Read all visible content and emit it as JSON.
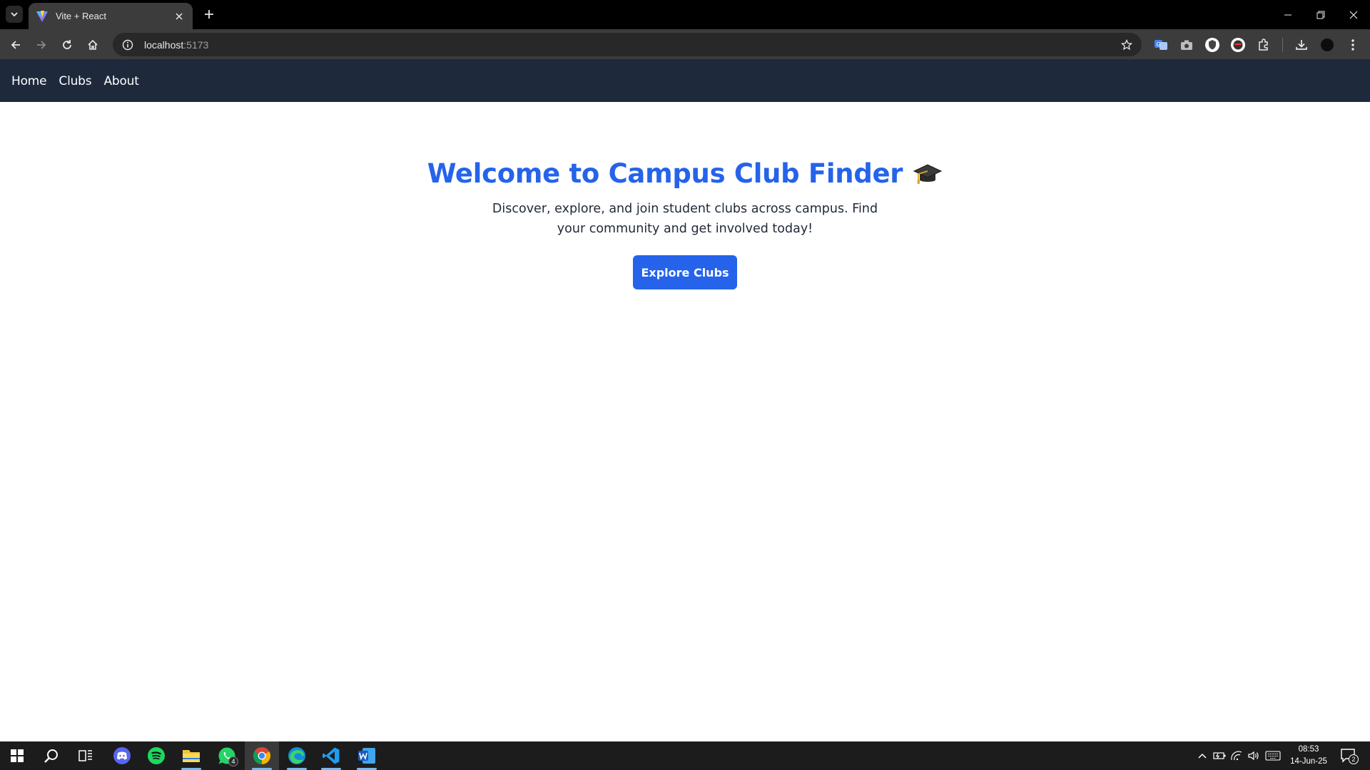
{
  "browser": {
    "tab": {
      "title": "Vite + React"
    },
    "address": {
      "host": "localhost",
      "port": ":5173"
    }
  },
  "nav": {
    "links": [
      "Home",
      "Clubs",
      "About"
    ]
  },
  "hero": {
    "title": "Welcome to Campus Club Finder",
    "description": "Discover, explore, and join student clubs across campus. Find your community and get involved today!",
    "cta_label": "Explore Clubs"
  },
  "taskbar": {
    "apps": [
      "start-icon",
      "search-icon",
      "task-view-icon",
      "discord-icon",
      "spotify-icon",
      "file-explorer-icon",
      "whatsapp-icon",
      "chrome-icon",
      "edge-icon",
      "vscode-icon",
      "word-icon"
    ],
    "whatsapp_badge": "4",
    "time": "08:53",
    "date": "14-Jun-25",
    "notification_count": "2"
  },
  "colors": {
    "accent": "#2563eb",
    "navbar": "#1e293b"
  }
}
